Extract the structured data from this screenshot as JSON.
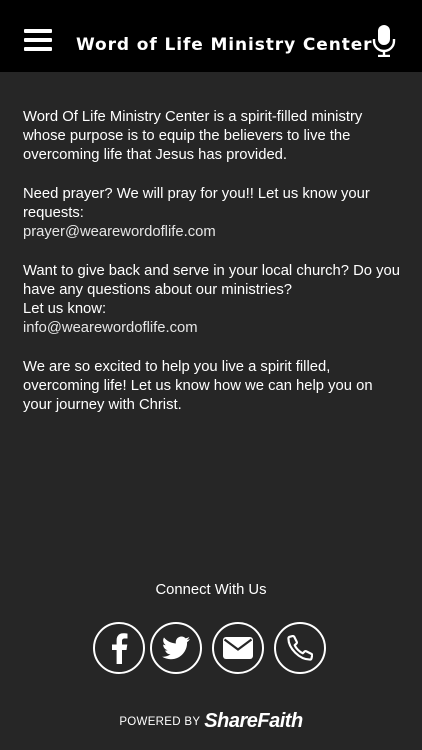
{
  "header": {
    "title": "Word of Life Ministry Center"
  },
  "content": {
    "intro": "Word Of Life Ministry Center is a spirit-filled ministry whose purpose is to equip the believers to live the overcoming life that Jesus has provided.",
    "prayer_text": "Need prayer? We will pray for you!! Let us know your requests:",
    "prayer_email": "prayer@wearewordoflife.com",
    "serve_text": "Want to give back and serve in your local church? Do you have any questions about our ministries?",
    "serve_let_us_know": "Let us know:",
    "info_email": "info@wearewordoflife.com",
    "closing": "We are so excited to help you live a spirit filled, overcoming life! Let us know how we can help you on your journey with Christ."
  },
  "connect": {
    "title": "Connect With Us",
    "buttons": [
      {
        "icon": "facebook-icon"
      },
      {
        "icon": "twitter-icon"
      },
      {
        "icon": "email-icon"
      },
      {
        "icon": "phone-icon"
      }
    ]
  },
  "footer": {
    "powered_by": "POWERED BY",
    "brand": "ShareFaith"
  },
  "colors": {
    "background": "#262626",
    "topbar": "#000000",
    "text": "#ffffff"
  }
}
